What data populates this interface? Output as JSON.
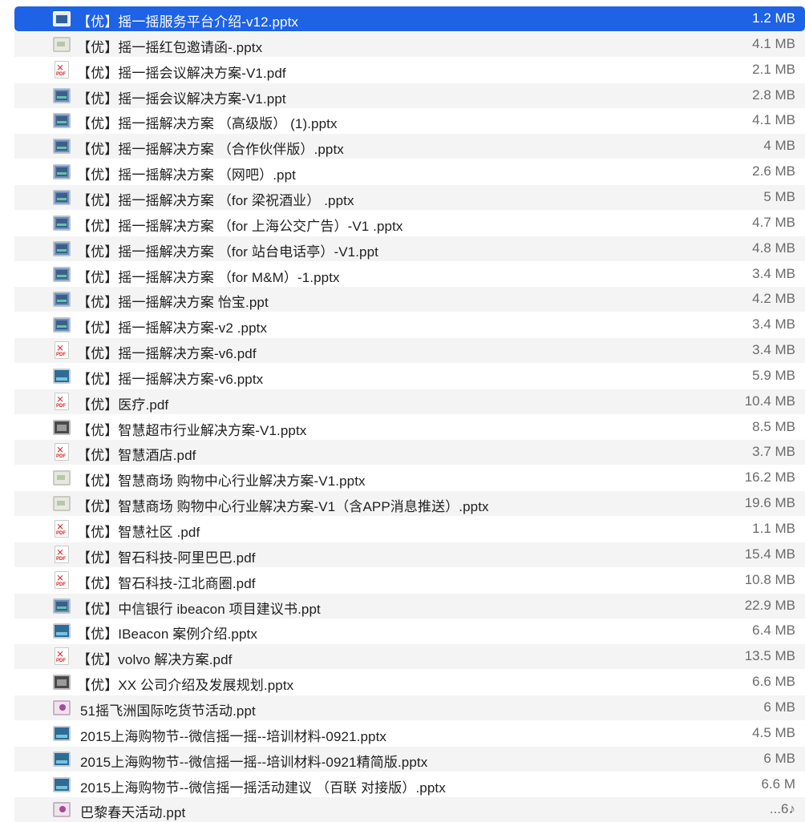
{
  "files": [
    {
      "name": "【优】摇一摇服务平台介绍-v12.pptx",
      "size": "1.2 MB",
      "icon": "presentation-selected-icon",
      "selected": true
    },
    {
      "name": "【优】摇一摇红包邀请函-.pptx",
      "size": "4.1 MB",
      "icon": "presentation-light-icon"
    },
    {
      "name": "【优】摇一摇会议解决方案-V1.pdf",
      "size": "2.1 MB",
      "icon": "pdf-icon"
    },
    {
      "name": "【优】摇一摇会议解决方案-V1.ppt",
      "size": "2.8 MB",
      "icon": "presentation-icon"
    },
    {
      "name": "【优】摇一摇解决方案 （高级版） (1).pptx",
      "size": "4.1 MB",
      "icon": "presentation-icon"
    },
    {
      "name": "【优】摇一摇解决方案 （合作伙伴版）.pptx",
      "size": "4 MB",
      "icon": "presentation-icon"
    },
    {
      "name": "【优】摇一摇解决方案 （网吧）.ppt",
      "size": "2.6 MB",
      "icon": "presentation-icon"
    },
    {
      "name": "【优】摇一摇解决方案 （for 梁祝酒业） .pptx",
      "size": "5 MB",
      "icon": "presentation-icon"
    },
    {
      "name": "【优】摇一摇解决方案 （for 上海公交广告）-V1 .pptx",
      "size": "4.7 MB",
      "icon": "presentation-icon"
    },
    {
      "name": "【优】摇一摇解决方案 （for 站台电话亭）-V1.ppt",
      "size": "4.8 MB",
      "icon": "presentation-icon"
    },
    {
      "name": "【优】摇一摇解决方案 （for M&M）-1.pptx",
      "size": "3.4 MB",
      "icon": "presentation-icon"
    },
    {
      "name": "【优】摇一摇解决方案 怡宝.ppt",
      "size": "4.2 MB",
      "icon": "presentation-icon"
    },
    {
      "name": "【优】摇一摇解决方案-v2 .pptx",
      "size": "3.4 MB",
      "icon": "presentation-icon"
    },
    {
      "name": "【优】摇一摇解决方案-v6.pdf",
      "size": "3.4 MB",
      "icon": "pdf-icon"
    },
    {
      "name": "【优】摇一摇解决方案-v6.pptx",
      "size": "5.9 MB",
      "icon": "presentation-blue-icon"
    },
    {
      "name": "【优】医疗.pdf",
      "size": "10.4 MB",
      "icon": "pdf-icon"
    },
    {
      "name": "【优】智慧超市行业解决方案-V1.pptx",
      "size": "8.5 MB",
      "icon": "presentation-dark-icon"
    },
    {
      "name": "【优】智慧酒店.pdf",
      "size": "3.7 MB",
      "icon": "pdf-icon"
    },
    {
      "name": "【优】智慧商场 购物中心行业解决方案-V1.pptx",
      "size": "16.2 MB",
      "icon": "presentation-light-icon"
    },
    {
      "name": "【优】智慧商场 购物中心行业解决方案-V1（含APP消息推送）.pptx",
      "size": "19.6 MB",
      "icon": "presentation-light-icon"
    },
    {
      "name": "【优】智慧社区 .pdf",
      "size": "1.1 MB",
      "icon": "pdf-icon"
    },
    {
      "name": "【优】智石科技-阿里巴巴.pdf",
      "size": "15.4 MB",
      "icon": "pdf-icon"
    },
    {
      "name": "【优】智石科技-江北商圈.pdf",
      "size": "10.8 MB",
      "icon": "pdf-icon"
    },
    {
      "name": "【优】中信银行 ibeacon 项目建议书.ppt",
      "size": "22.9 MB",
      "icon": "presentation-icon"
    },
    {
      "name": "【优】IBeacon 案例介绍.pptx",
      "size": "6.4 MB",
      "icon": "presentation-blue-icon"
    },
    {
      "name": "【优】volvo 解决方案.pdf",
      "size": "13.5 MB",
      "icon": "pdf-icon"
    },
    {
      "name": "【优】XX 公司介绍及发展规划.pptx",
      "size": "6.6 MB",
      "icon": "presentation-dark-icon"
    },
    {
      "name": "51摇飞洲国际吃货节活动.ppt",
      "size": "6 MB",
      "icon": "presentation-pink-icon",
      "top": true
    },
    {
      "name": "2015上海购物节--微信摇一摇--培训材料-0921.pptx",
      "size": "4.5 MB",
      "icon": "presentation-blue-icon",
      "top": true
    },
    {
      "name": "2015上海购物节--微信摇一摇--培训材料-0921精简版.pptx",
      "size": "6 MB",
      "icon": "presentation-blue-icon",
      "top": true
    },
    {
      "name": "2015上海购物节--微信摇一摇活动建议 （百联 对接版）.pptx",
      "size": "6.6 M",
      "icon": "presentation-blue-icon",
      "top": true
    },
    {
      "name": "巴黎春天活动.ppt",
      "size": "...6♪",
      "icon": "presentation-pink-icon",
      "top": true
    }
  ]
}
